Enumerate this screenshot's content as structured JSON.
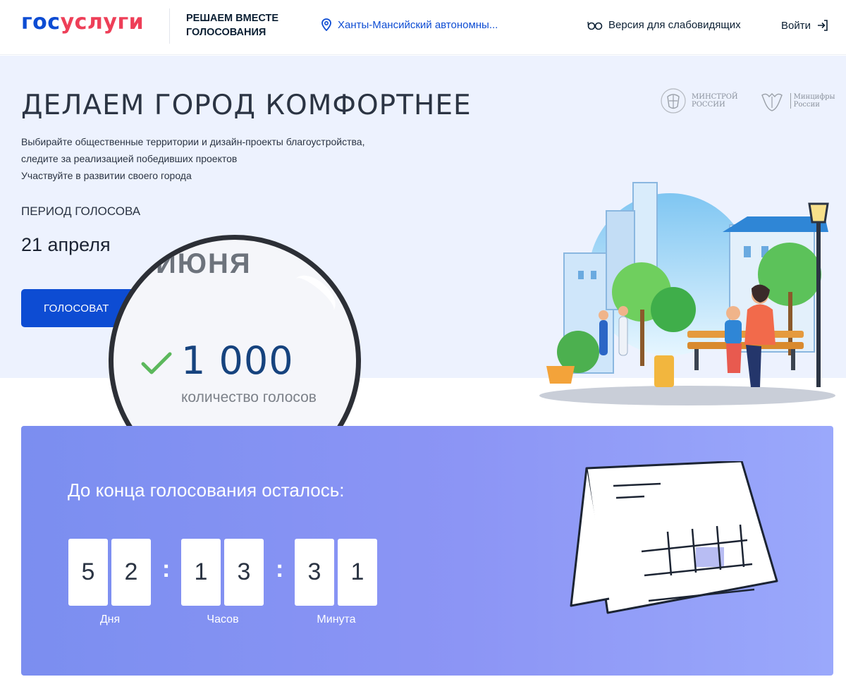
{
  "header": {
    "logo_gos": "гос",
    "logo_uslugi": "услуги",
    "tagline": "РЕШАЕМ ВМЕСТЕ ГОЛОСОВАНИЯ",
    "region": "Ханты-Мансийский автономны...",
    "low_vision": "Версия для слабовидящих",
    "login": "Войти"
  },
  "hero": {
    "title": "ДЕЛАЕМ ГОРОД КОМФОРТНЕЕ",
    "desc_line1": "Выбирайте общественные территории и дизайн-проекты благоустройства,",
    "desc_line2": "следите за реализацией победивших проектов",
    "desc_line3": "Участвуйте в развитии своего города",
    "period_label": "ПЕРИОД ГОЛОСОВА",
    "period_value": "21 апреля",
    "vote_button": "ГОЛОСОВАТ",
    "partners": [
      {
        "name_line1": "МИНСТРОЙ",
        "name_line2": "РОССИИ"
      },
      {
        "name_line1": "Минцифры",
        "name_line2": "России"
      }
    ]
  },
  "magnifier": {
    "top_text": "ИЮНЯ",
    "count": "1 000",
    "count_label": "количество голосов"
  },
  "countdown": {
    "title": "До конца голосования осталось:",
    "days": [
      "5",
      "2"
    ],
    "hours": [
      "1",
      "3"
    ],
    "minutes": [
      "3",
      "1"
    ],
    "days_label": "Дня",
    "hours_label": "Часов",
    "minutes_label": "Минута"
  },
  "colors": {
    "brand_blue": "#0d4cd3",
    "brand_red": "#ee3f58",
    "hero_bg": "#edf2fe",
    "countdown_bg": "#8c95f5"
  }
}
